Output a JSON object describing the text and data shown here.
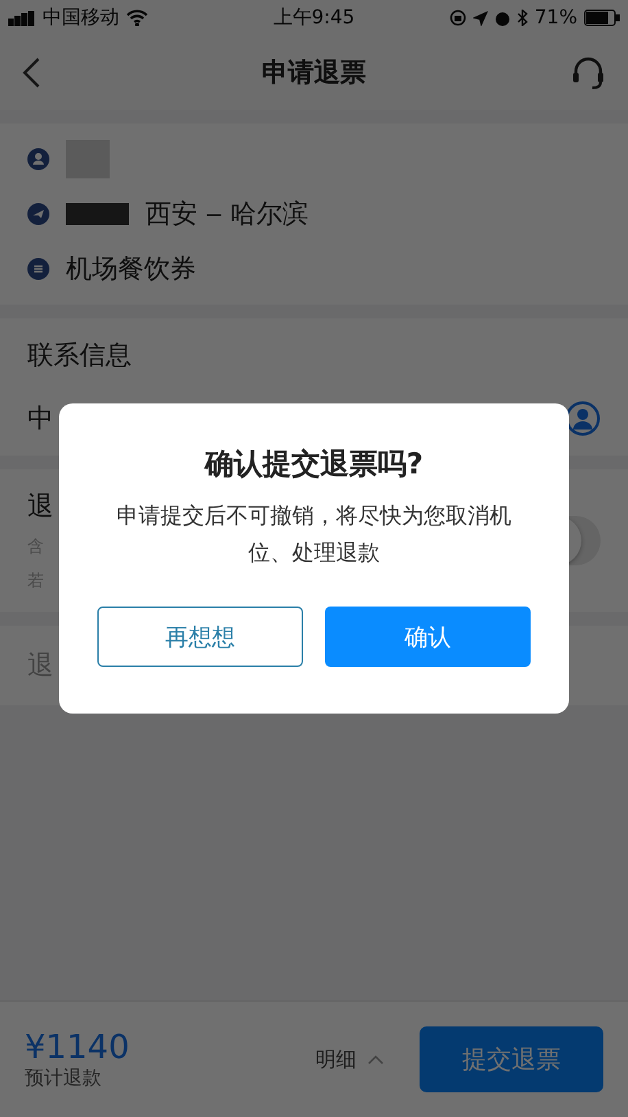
{
  "status_bar": {
    "carrier": "中国移动",
    "time": "上午9:45",
    "battery": "71%"
  },
  "nav": {
    "title": "申请退票"
  },
  "trip": {
    "route": "西安 ‒ 哈尔滨",
    "product": "机场餐饮券"
  },
  "contact": {
    "heading": "联系信息",
    "value": "中"
  },
  "refund": {
    "heading": "退",
    "line_1": "含",
    "line_2": "若",
    "toggle": {
      "on": false
    }
  },
  "reason": {
    "label": "退"
  },
  "footer": {
    "amount": "¥1140",
    "amount_label": "预计退款",
    "details": "明细",
    "submit": "提交退票"
  },
  "dialog": {
    "title": "确认提交退票吗?",
    "message": "申请提交后不可撤销，将尽快为您取消机位、处理退款",
    "buttons": [
      {
        "label": "再想想",
        "kind": "secondary"
      },
      {
        "label": "确认",
        "kind": "primary"
      }
    ]
  }
}
